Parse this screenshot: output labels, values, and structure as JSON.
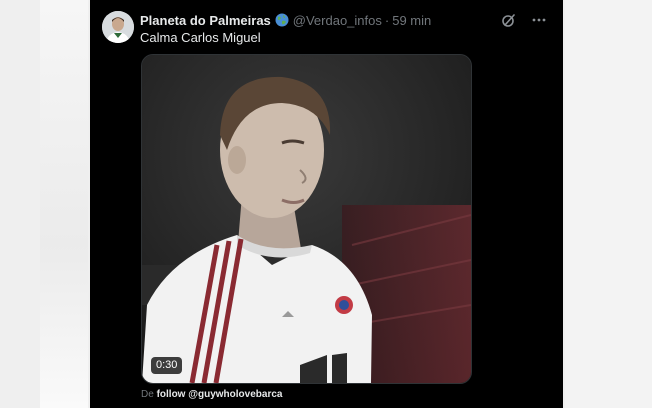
{
  "tweet": {
    "display_name": "Planeta do Palmeiras",
    "badge_icon": "globe-icon",
    "handle": "@Verdao_infos",
    "separator": "·",
    "time": "59 min",
    "text": "Calma Carlos Miguel",
    "actions": [
      "grok-icon",
      "more-icon"
    ]
  },
  "media": {
    "type": "video",
    "duration": "0:30"
  },
  "attribution": {
    "prefix": "De",
    "source": "follow @guywholovebarca"
  },
  "colors": {
    "background": "#000000",
    "text": "#e7e9ea",
    "secondary_text": "#71767b"
  }
}
